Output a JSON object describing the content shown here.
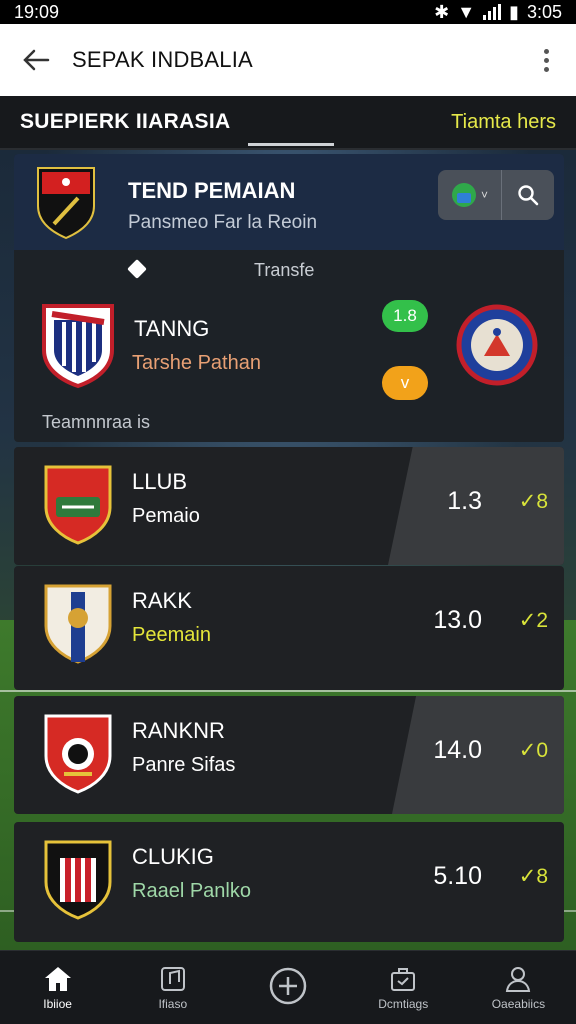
{
  "status": {
    "time": "19:09",
    "right_time": "3:05"
  },
  "appbar": {
    "title": "SEPAK INDBALIA"
  },
  "section": {
    "label": "SUEPIERK IIARASIA",
    "link": "Tiamta hers"
  },
  "topcard": {
    "title": "TEND PEMAIAN",
    "subtitle": "Pansmeo Far la Reoin",
    "transfer": "Transfe",
    "team_name": "TANNG",
    "team_sub": "Tarshe Pathan",
    "badge_green": "1.8",
    "badge_orange": "v",
    "footer": "Teamnnraa is"
  },
  "rows": [
    {
      "name": "LLUB",
      "sub": "Pemaio",
      "value": "1.3",
      "check": "✓8",
      "sub_color": "#ffffff"
    },
    {
      "name": "RAKK",
      "sub": "Peemain",
      "value": "13.0",
      "check": "✓2",
      "sub_color": "#e4e63a"
    },
    {
      "name": "RANKNR",
      "sub": "Panre Sifas",
      "value": "14.0",
      "check": "✓0",
      "sub_color": "#ffffff"
    },
    {
      "name": "CLUKIG",
      "sub": "Raael Panlko",
      "value": "5.10",
      "check": "✓8",
      "sub_color": "#9fd8a8"
    }
  ],
  "nav": [
    {
      "label": "Ibiioe",
      "icon": "home-icon"
    },
    {
      "label": "Ifiaso",
      "icon": "music-icon"
    },
    {
      "label": "",
      "icon": "add-circle-icon"
    },
    {
      "label": "Dcmtiags",
      "icon": "briefcase-icon"
    },
    {
      "label": "Oaeabiics",
      "icon": "profile-icon"
    }
  ]
}
